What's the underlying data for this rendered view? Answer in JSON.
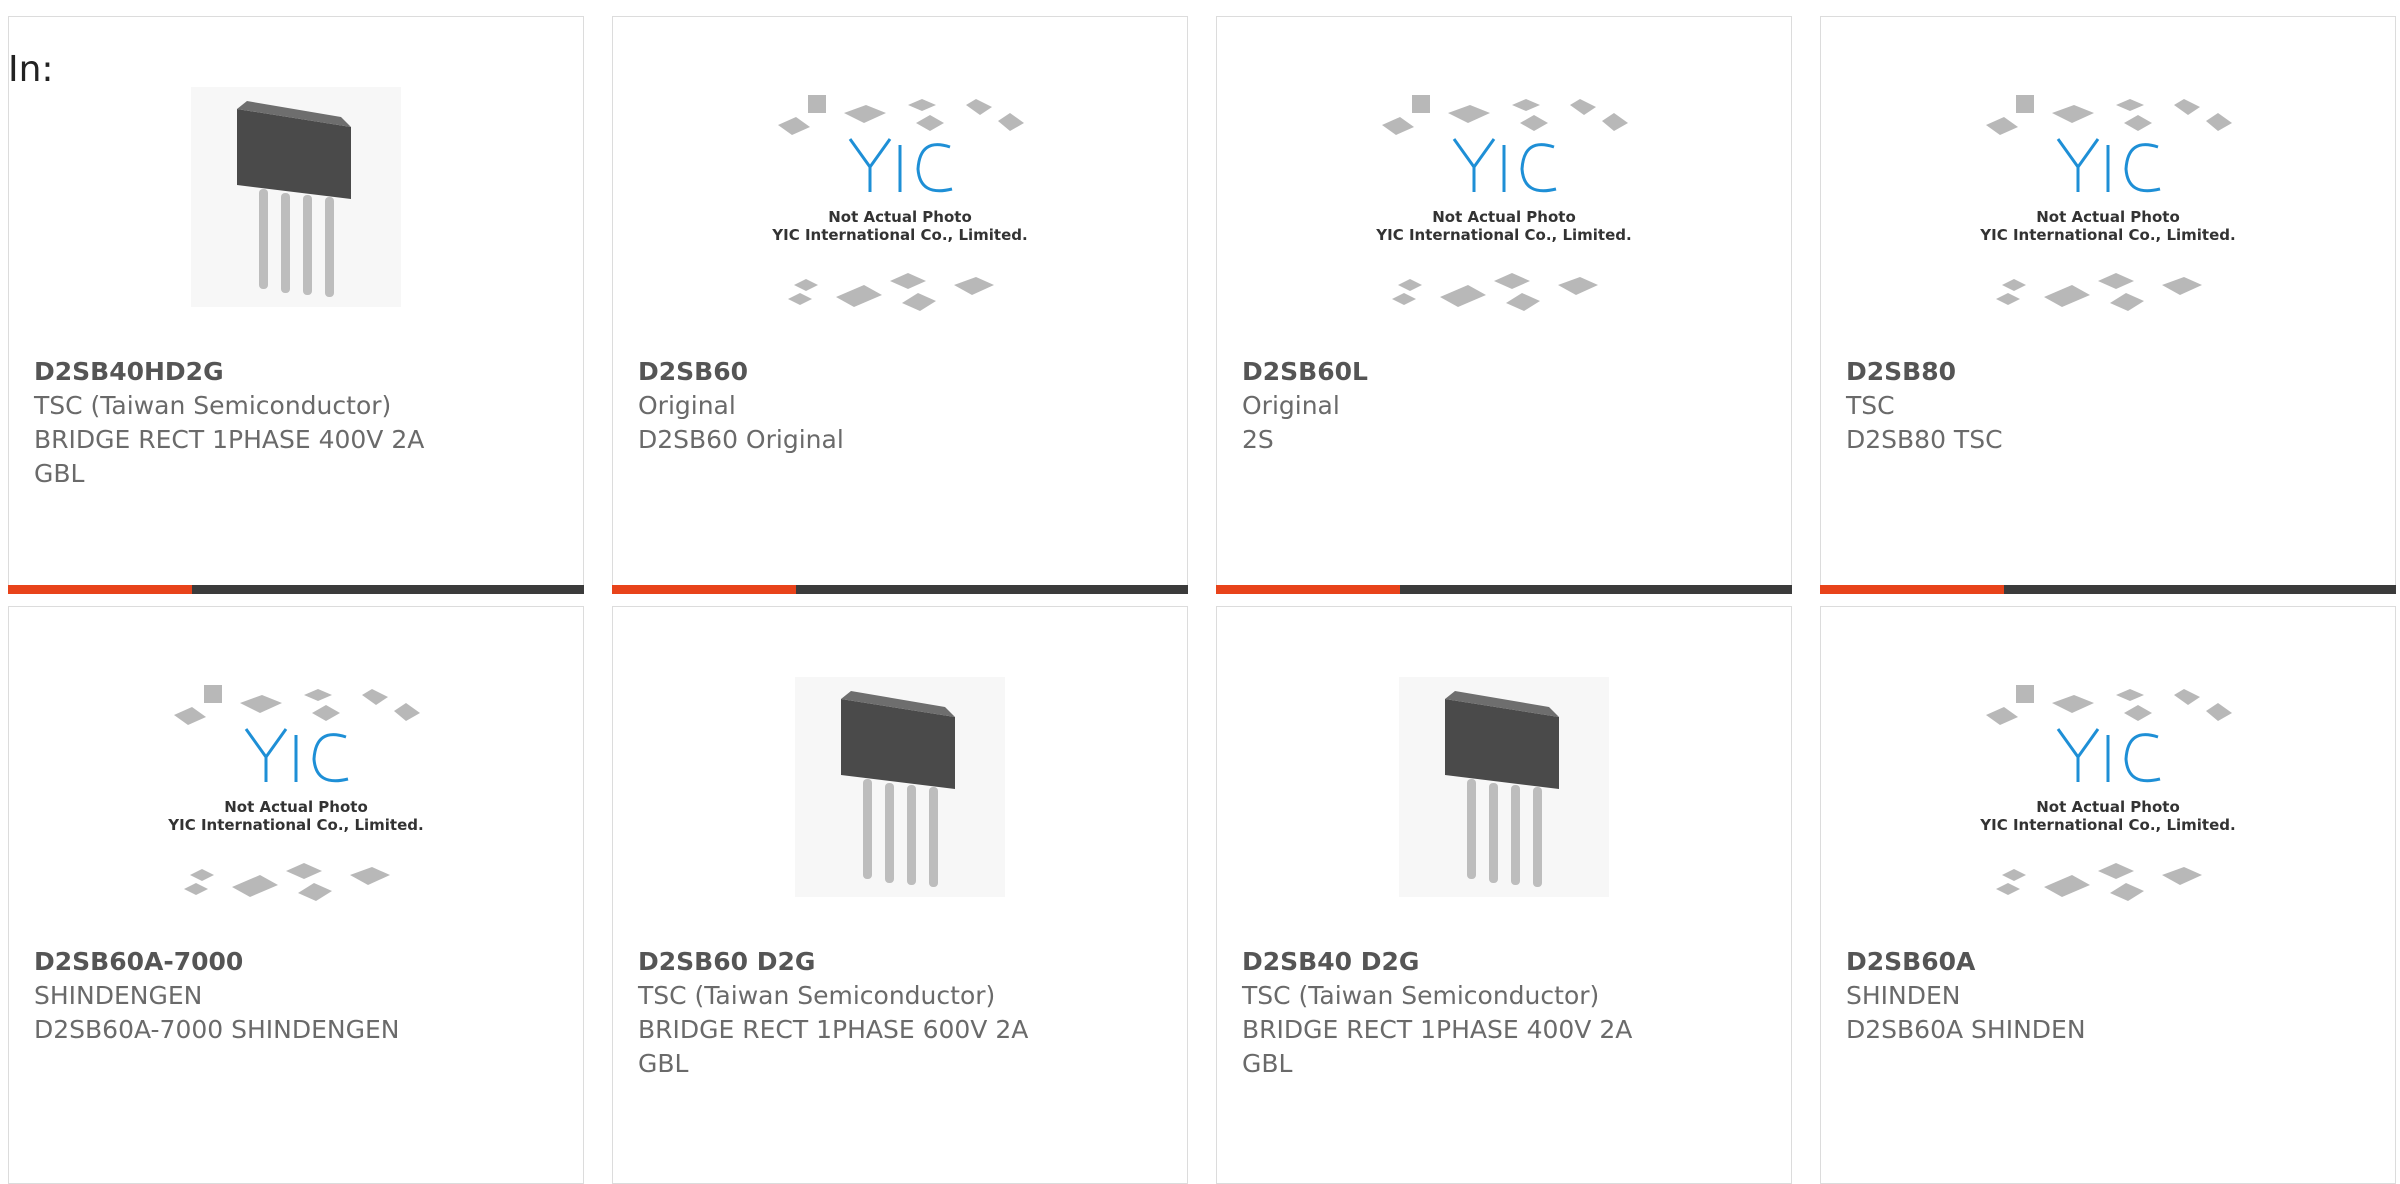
{
  "header": {
    "in_label": "In:"
  },
  "colors": {
    "accent": "#e8431a",
    "bar_dark": "#3b3b3b",
    "card_border": "#dcdcdc",
    "logo_blue": "#1e8fd6"
  },
  "cards": [
    {
      "image": "bridge-rectifier-photo",
      "title": "D2SB40HD2G",
      "lines": [
        "TSC (Taiwan Semiconductor)",
        "BRIDGE RECT 1PHASE 400V 2A",
        "GBL"
      ]
    },
    {
      "image": "yic-placeholder",
      "placeholder_text_1": "Not Actual Photo",
      "placeholder_text_2": "YIC International Co., Limited.",
      "title": "D2SB60",
      "lines": [
        "Original",
        "D2SB60 Original",
        ""
      ]
    },
    {
      "image": "yic-placeholder",
      "placeholder_text_1": "Not Actual Photo",
      "placeholder_text_2": "YIC International Co., Limited.",
      "title": "D2SB60L",
      "lines": [
        "Original",
        "2S",
        ""
      ]
    },
    {
      "image": "yic-placeholder",
      "placeholder_text_1": "Not Actual Photo",
      "placeholder_text_2": "YIC International Co., Limited.",
      "title": "D2SB80",
      "lines": [
        "TSC",
        "D2SB80 TSC",
        ""
      ]
    },
    {
      "image": "yic-placeholder",
      "placeholder_text_1": "Not Actual Photo",
      "placeholder_text_2": "YIC International Co., Limited.",
      "title": "D2SB60A-7000",
      "lines": [
        "SHINDENGEN",
        "D2SB60A-7000 SHINDENGEN",
        ""
      ]
    },
    {
      "image": "bridge-rectifier-photo",
      "title": "D2SB60 D2G",
      "lines": [
        "TSC (Taiwan Semiconductor)",
        "BRIDGE RECT 1PHASE 600V 2A",
        "GBL"
      ]
    },
    {
      "image": "bridge-rectifier-photo",
      "title": "D2SB40 D2G",
      "lines": [
        "TSC (Taiwan Semiconductor)",
        "BRIDGE RECT 1PHASE 400V 2A",
        "GBL"
      ]
    },
    {
      "image": "yic-placeholder",
      "placeholder_text_1": "Not Actual Photo",
      "placeholder_text_2": "YIC International Co., Limited.",
      "title": "D2SB60A",
      "lines": [
        "SHINDEN",
        "D2SB60A SHINDEN",
        ""
      ]
    }
  ]
}
